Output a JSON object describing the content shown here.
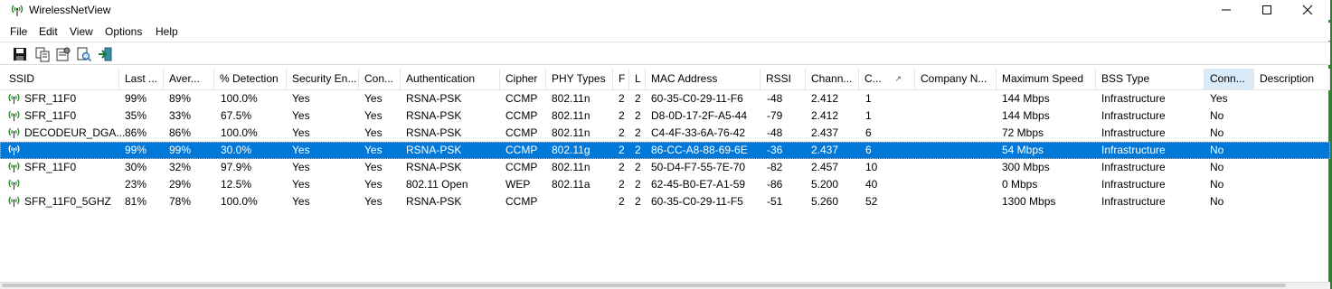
{
  "window": {
    "title": "WirelessNetView",
    "accent": "#2f8a2f"
  },
  "menu": [
    "File",
    "Edit",
    "View",
    "Options",
    "Help"
  ],
  "toolbar": {
    "icons": [
      "save-icon",
      "copy-icon",
      "properties-icon",
      "find-icon",
      "exit-icon"
    ]
  },
  "columns": [
    "SSID",
    "Last ...",
    "Aver...",
    "% Detection",
    "Security En...",
    "Con...",
    "Authentication",
    "Cipher",
    "PHY Types",
    "F",
    "L",
    "MAC Address",
    "RSSI",
    "Chann...",
    "C...",
    "Company N...",
    "Maximum Speed",
    "BSS Type",
    "Conn...",
    "Description"
  ],
  "rows": [
    [
      "SFR_11F0",
      "99%",
      "89%",
      "100.0%",
      "Yes",
      "Yes",
      "RSNA-PSK",
      "CCMP",
      "802.11n",
      "2",
      "2",
      "60-35-C0-29-11-F6",
      "-48",
      "2.412",
      "1",
      "",
      "144 Mbps",
      "Infrastructure",
      "Yes",
      ""
    ],
    [
      "SFR_11F0",
      "35%",
      "33%",
      "67.5%",
      "Yes",
      "Yes",
      "RSNA-PSK",
      "CCMP",
      "802.11n",
      "2",
      "2",
      "D8-0D-17-2F-A5-44",
      "-79",
      "2.412",
      "1",
      "",
      "144 Mbps",
      "Infrastructure",
      "No",
      ""
    ],
    [
      "DECODEUR_DGA...",
      "86%",
      "86%",
      "100.0%",
      "Yes",
      "Yes",
      "RSNA-PSK",
      "CCMP",
      "802.11n",
      "2",
      "2",
      "C4-4F-33-6A-76-42",
      "-48",
      "2.437",
      "6",
      "",
      "72 Mbps",
      "Infrastructure",
      "No",
      ""
    ],
    [
      "",
      "99%",
      "99%",
      "30.0%",
      "Yes",
      "Yes",
      "RSNA-PSK",
      "CCMP",
      "802.11g",
      "2",
      "2",
      "86-CC-A8-88-69-6E",
      "-36",
      "2.437",
      "6",
      "",
      "54 Mbps",
      "Infrastructure",
      "No",
      ""
    ],
    [
      "SFR_11F0",
      "30%",
      "32%",
      "97.9%",
      "Yes",
      "Yes",
      "RSNA-PSK",
      "CCMP",
      "802.11n",
      "2",
      "2",
      "50-D4-F7-55-7E-70",
      "-82",
      "2.457",
      "10",
      "",
      "300 Mbps",
      "Infrastructure",
      "No",
      ""
    ],
    [
      "",
      "23%",
      "29%",
      "12.5%",
      "Yes",
      "Yes",
      "802.11 Open",
      "WEP",
      "802.11a",
      "2",
      "2",
      "62-45-B0-E7-A1-59",
      "-86",
      "5.200",
      "40",
      "",
      "0 Mbps",
      "Infrastructure",
      "No",
      ""
    ],
    [
      "SFR_11F0_5GHZ",
      "81%",
      "78%",
      "100.0%",
      "Yes",
      "Yes",
      "RSNA-PSK",
      "CCMP",
      "",
      "2",
      "2",
      "60-35-C0-29-11-F5",
      "-51",
      "5.260",
      "52",
      "",
      "1300 Mbps",
      "Infrastructure",
      "No",
      ""
    ]
  ],
  "selected_row_index": 3
}
